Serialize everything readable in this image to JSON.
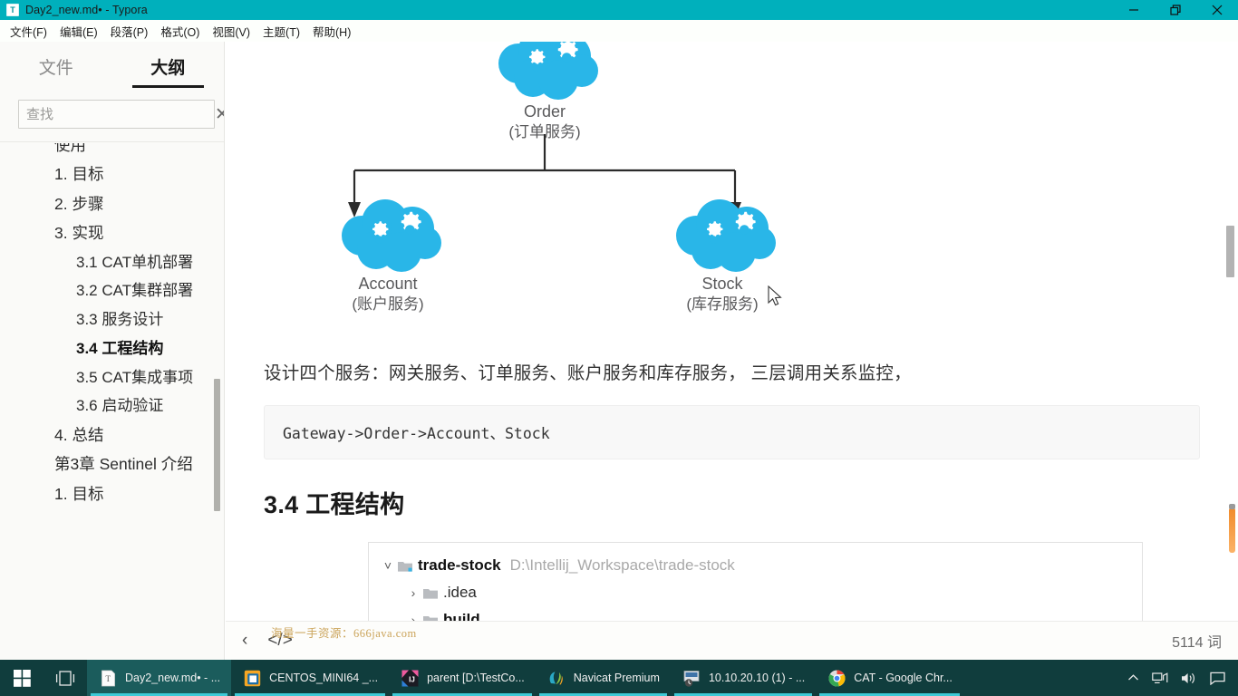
{
  "window": {
    "title": "Day2_new.md• - Typora",
    "app_icon": "typora-t-icon",
    "titlebar_color": "#00b0bc",
    "controls": {
      "minimize": "minimize-icon",
      "restore": "restore-icon",
      "close": "close-icon"
    }
  },
  "menubar": {
    "items": [
      {
        "label": "文件(F)"
      },
      {
        "label": "编辑(E)"
      },
      {
        "label": "段落(P)"
      },
      {
        "label": "格式(O)"
      },
      {
        "label": "视图(V)"
      },
      {
        "label": "主题(T)"
      },
      {
        "label": "帮助(H)"
      }
    ]
  },
  "sidebar": {
    "tabs": [
      {
        "label": "文件",
        "active": false
      },
      {
        "label": "大纲",
        "active": true
      }
    ],
    "search": {
      "value": "",
      "placeholder": "查找",
      "clear_icon": "close-icon"
    },
    "outline": [
      {
        "label": "使用",
        "level": 0,
        "active": false,
        "clipped": true
      },
      {
        "label": "1. 目标",
        "level": 0,
        "active": false
      },
      {
        "label": "2. 步骤",
        "level": 0,
        "active": false
      },
      {
        "label": "3. 实现",
        "level": 0,
        "active": false
      },
      {
        "label": "3.1 CAT单机部署",
        "level": 1,
        "active": false
      },
      {
        "label": "3.2 CAT集群部署",
        "level": 1,
        "active": false
      },
      {
        "label": "3.3 服务设计",
        "level": 1,
        "active": false
      },
      {
        "label": "3.4 工程结构",
        "level": 1,
        "active": true
      },
      {
        "label": "3.5 CAT集成事项",
        "level": 1,
        "active": false
      },
      {
        "label": "3.6 启动验证",
        "level": 1,
        "active": false
      },
      {
        "label": "4. 总结",
        "level": 0,
        "active": false
      },
      {
        "label": "第3章 Sentinel 介绍",
        "level": 0,
        "active": false
      },
      {
        "label": "1. 目标",
        "level": 0,
        "active": false
      }
    ]
  },
  "document": {
    "diagram": {
      "nodes": [
        {
          "id": "order",
          "label": "Order",
          "sublabel": "(订单服务)",
          "icon": "cloud-gears-icon"
        },
        {
          "id": "account",
          "label": "Account",
          "sublabel": "(账户服务)",
          "icon": "cloud-gears-icon"
        },
        {
          "id": "stock",
          "label": "Stock",
          "sublabel": "(库存服务)",
          "icon": "cloud-gears-icon"
        }
      ],
      "cloud_color": "#29b6e8",
      "edges": [
        {
          "from": "order",
          "to": "account"
        },
        {
          "from": "order",
          "to": "stock"
        }
      ]
    },
    "paragraph": "设计四个服务：网关服务、订单服务、账户服务和库存服务， 三层调用关系监控，",
    "code_block": "Gateway->Order->Account、Stock",
    "heading": "3.4 工程结构",
    "file_tree": [
      {
        "name": "trade-stock",
        "path": "D:\\Intellij_Workspace\\trade-stock",
        "expanded": true,
        "indent": 0,
        "bold": true
      },
      {
        "name": ".idea",
        "path": "",
        "expanded": false,
        "indent": 1,
        "bold": false
      },
      {
        "name": "build",
        "path": "",
        "expanded": false,
        "indent": 1,
        "bold": false
      }
    ]
  },
  "statusbar": {
    "back_icon": "chevron-left-icon",
    "source_icon": "code-brackets-icon",
    "word_count": "5114 词",
    "watermark": "海量一手资源：666java.com",
    "watermark_color": "#cba45a"
  },
  "taskbar": {
    "background": "#103d3d",
    "start_icon": "windows-start-icon",
    "taskview_icon": "task-view-icon",
    "items": [
      {
        "label": "Day2_new.md• - ...",
        "icon": "typora-icon",
        "active": true
      },
      {
        "label": "CENTOS_MINI64 _...",
        "icon": "vmware-icon",
        "active": false
      },
      {
        "label": "parent [D:\\TestCo...",
        "icon": "intellij-idea-icon",
        "active": false
      },
      {
        "label": "Navicat Premium",
        "icon": "navicat-icon",
        "active": false
      },
      {
        "label": "10.10.20.10 (1) - ...",
        "icon": "remote-desktop-icon",
        "active": false
      },
      {
        "label": "CAT - Google Chr...",
        "icon": "chrome-icon",
        "active": false
      }
    ],
    "tray": [
      {
        "icon": "chevron-up-icon"
      },
      {
        "icon": "network-icon"
      },
      {
        "icon": "volume-icon"
      },
      {
        "icon": "action-center-icon"
      }
    ]
  }
}
